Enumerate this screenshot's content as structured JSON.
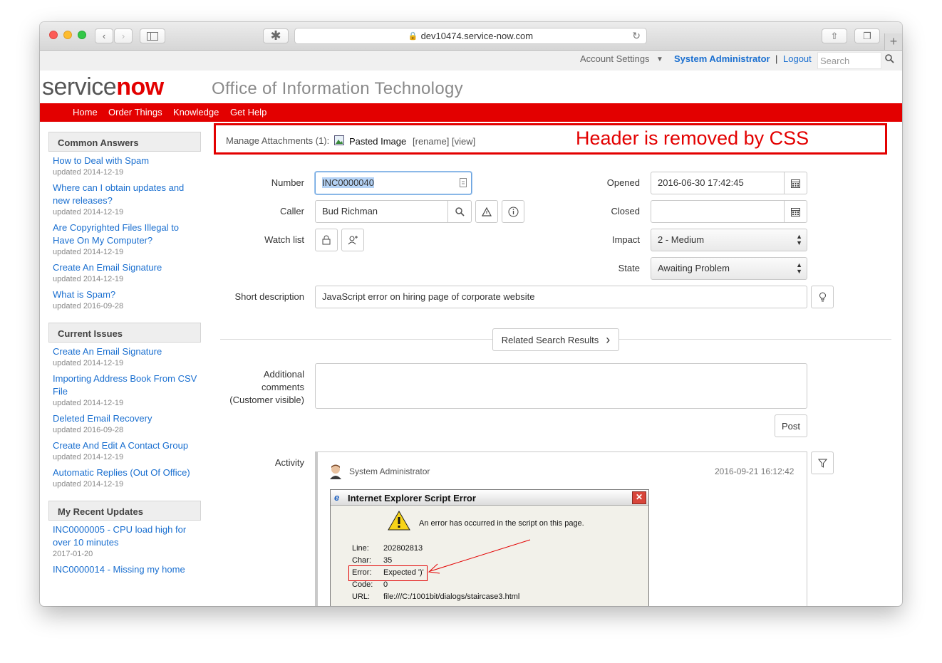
{
  "browser": {
    "url": "dev10474.service-now.com"
  },
  "util_bar": {
    "account_settings": "Account Settings",
    "user": "System Administrator",
    "separator": "|",
    "logout": "Logout",
    "search_placeholder": "Search"
  },
  "header": {
    "logo_service": "service",
    "logo_now": "now",
    "site_title": "Office of Information Technology"
  },
  "nav": {
    "items": [
      "Home",
      "Order Things",
      "Knowledge",
      "Get Help"
    ]
  },
  "sidebar": {
    "sections": [
      {
        "title": "Common Answers",
        "items": [
          {
            "label": "How to Deal with Spam",
            "date": "updated 2014-12-19"
          },
          {
            "label": "Where can I obtain updates and new releases?",
            "date": "updated 2014-12-19"
          },
          {
            "label": "Are Copyrighted Files Illegal to Have On My Computer?",
            "date": "updated 2014-12-19"
          },
          {
            "label": "Create An Email Signature",
            "date": "updated 2014-12-19"
          },
          {
            "label": "What is Spam?",
            "date": "updated 2016-09-28"
          }
        ]
      },
      {
        "title": "Current Issues",
        "items": [
          {
            "label": "Create An Email Signature",
            "date": "updated 2014-12-19"
          },
          {
            "label": "Importing Address Book From CSV File",
            "date": "updated 2014-12-19"
          },
          {
            "label": "Deleted Email Recovery",
            "date": "updated 2016-09-28"
          },
          {
            "label": "Create And Edit A Contact Group",
            "date": "updated 2014-12-19"
          },
          {
            "label": "Automatic Replies (Out Of Office)",
            "date": "updated 2014-12-19"
          }
        ]
      },
      {
        "title": "My Recent Updates",
        "items": [
          {
            "label": "INC0000005 - CPU load high for over 10 minutes",
            "date": "2017-01-20"
          },
          {
            "label": "INC0000014 - Missing my home",
            "date": ""
          }
        ]
      }
    ]
  },
  "attachments": {
    "label": "Manage Attachments (1):",
    "file": "Pasted Image",
    "rename": "[rename]",
    "view": "[view]",
    "annotation": "Header is removed by CSS"
  },
  "form": {
    "number_label": "Number",
    "number_value": "INC0000040",
    "caller_label": "Caller",
    "caller_value": "Bud Richman",
    "watch_label": "Watch list",
    "opened_label": "Opened",
    "opened_value": "2016-06-30 17:42:45",
    "closed_label": "Closed",
    "closed_value": "",
    "impact_label": "Impact",
    "impact_value": "2 - Medium",
    "state_label": "State",
    "state_value": "Awaiting Problem",
    "short_desc_label": "Short description",
    "short_desc_value": "JavaScript error on hiring page of corporate website",
    "related_search": "Related Search Results",
    "comments_label_1": "Additional",
    "comments_label_2": "comments",
    "comments_label_3": "(Customer visible)",
    "post_button": "Post",
    "activity_label": "Activity"
  },
  "activity_entry": {
    "author": "System Administrator",
    "timestamp": "2016-09-21 16:12:42"
  },
  "ie_dialog": {
    "title": "Internet Explorer Script Error",
    "message": "An error has occurred in the script on this page.",
    "rows": [
      {
        "key": "Line:",
        "value": "202802813"
      },
      {
        "key": "Char:",
        "value": "35"
      },
      {
        "key": "Error:",
        "value": "Expected ')'"
      },
      {
        "key": "Code:",
        "value": "0"
      },
      {
        "key": "URL:",
        "value": "file:///C:/1001bit/dialogs/staircase3.html"
      }
    ]
  },
  "colors": {
    "brand_red": "#e30000",
    "link_blue": "#1a6fd0"
  }
}
